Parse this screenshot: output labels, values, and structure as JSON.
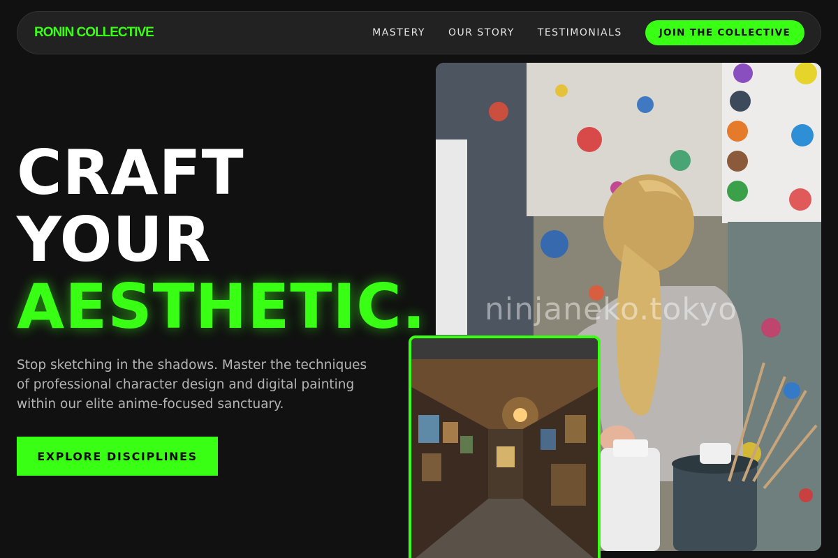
{
  "brand": {
    "name": "RONIN COLLECTIVE",
    "accent_color": "#39ff14"
  },
  "nav": {
    "links": [
      "MASTERY",
      "OUR STORY",
      "TESTIMONIALS"
    ],
    "cta_label": "JOIN THE COLLECTIVE"
  },
  "hero": {
    "headline_line1": "CRAFT",
    "headline_line2": "YOUR",
    "headline_accent": "AESTHETIC.",
    "subtext": "Stop sketching in the shadows. Master the techniques of professional character design and digital painting within our elite anime-focused sanctuary.",
    "cta_label": "EXPLORE DISCIPLINES"
  },
  "images": {
    "main_watermark": "ninjaneko.tokyo"
  }
}
